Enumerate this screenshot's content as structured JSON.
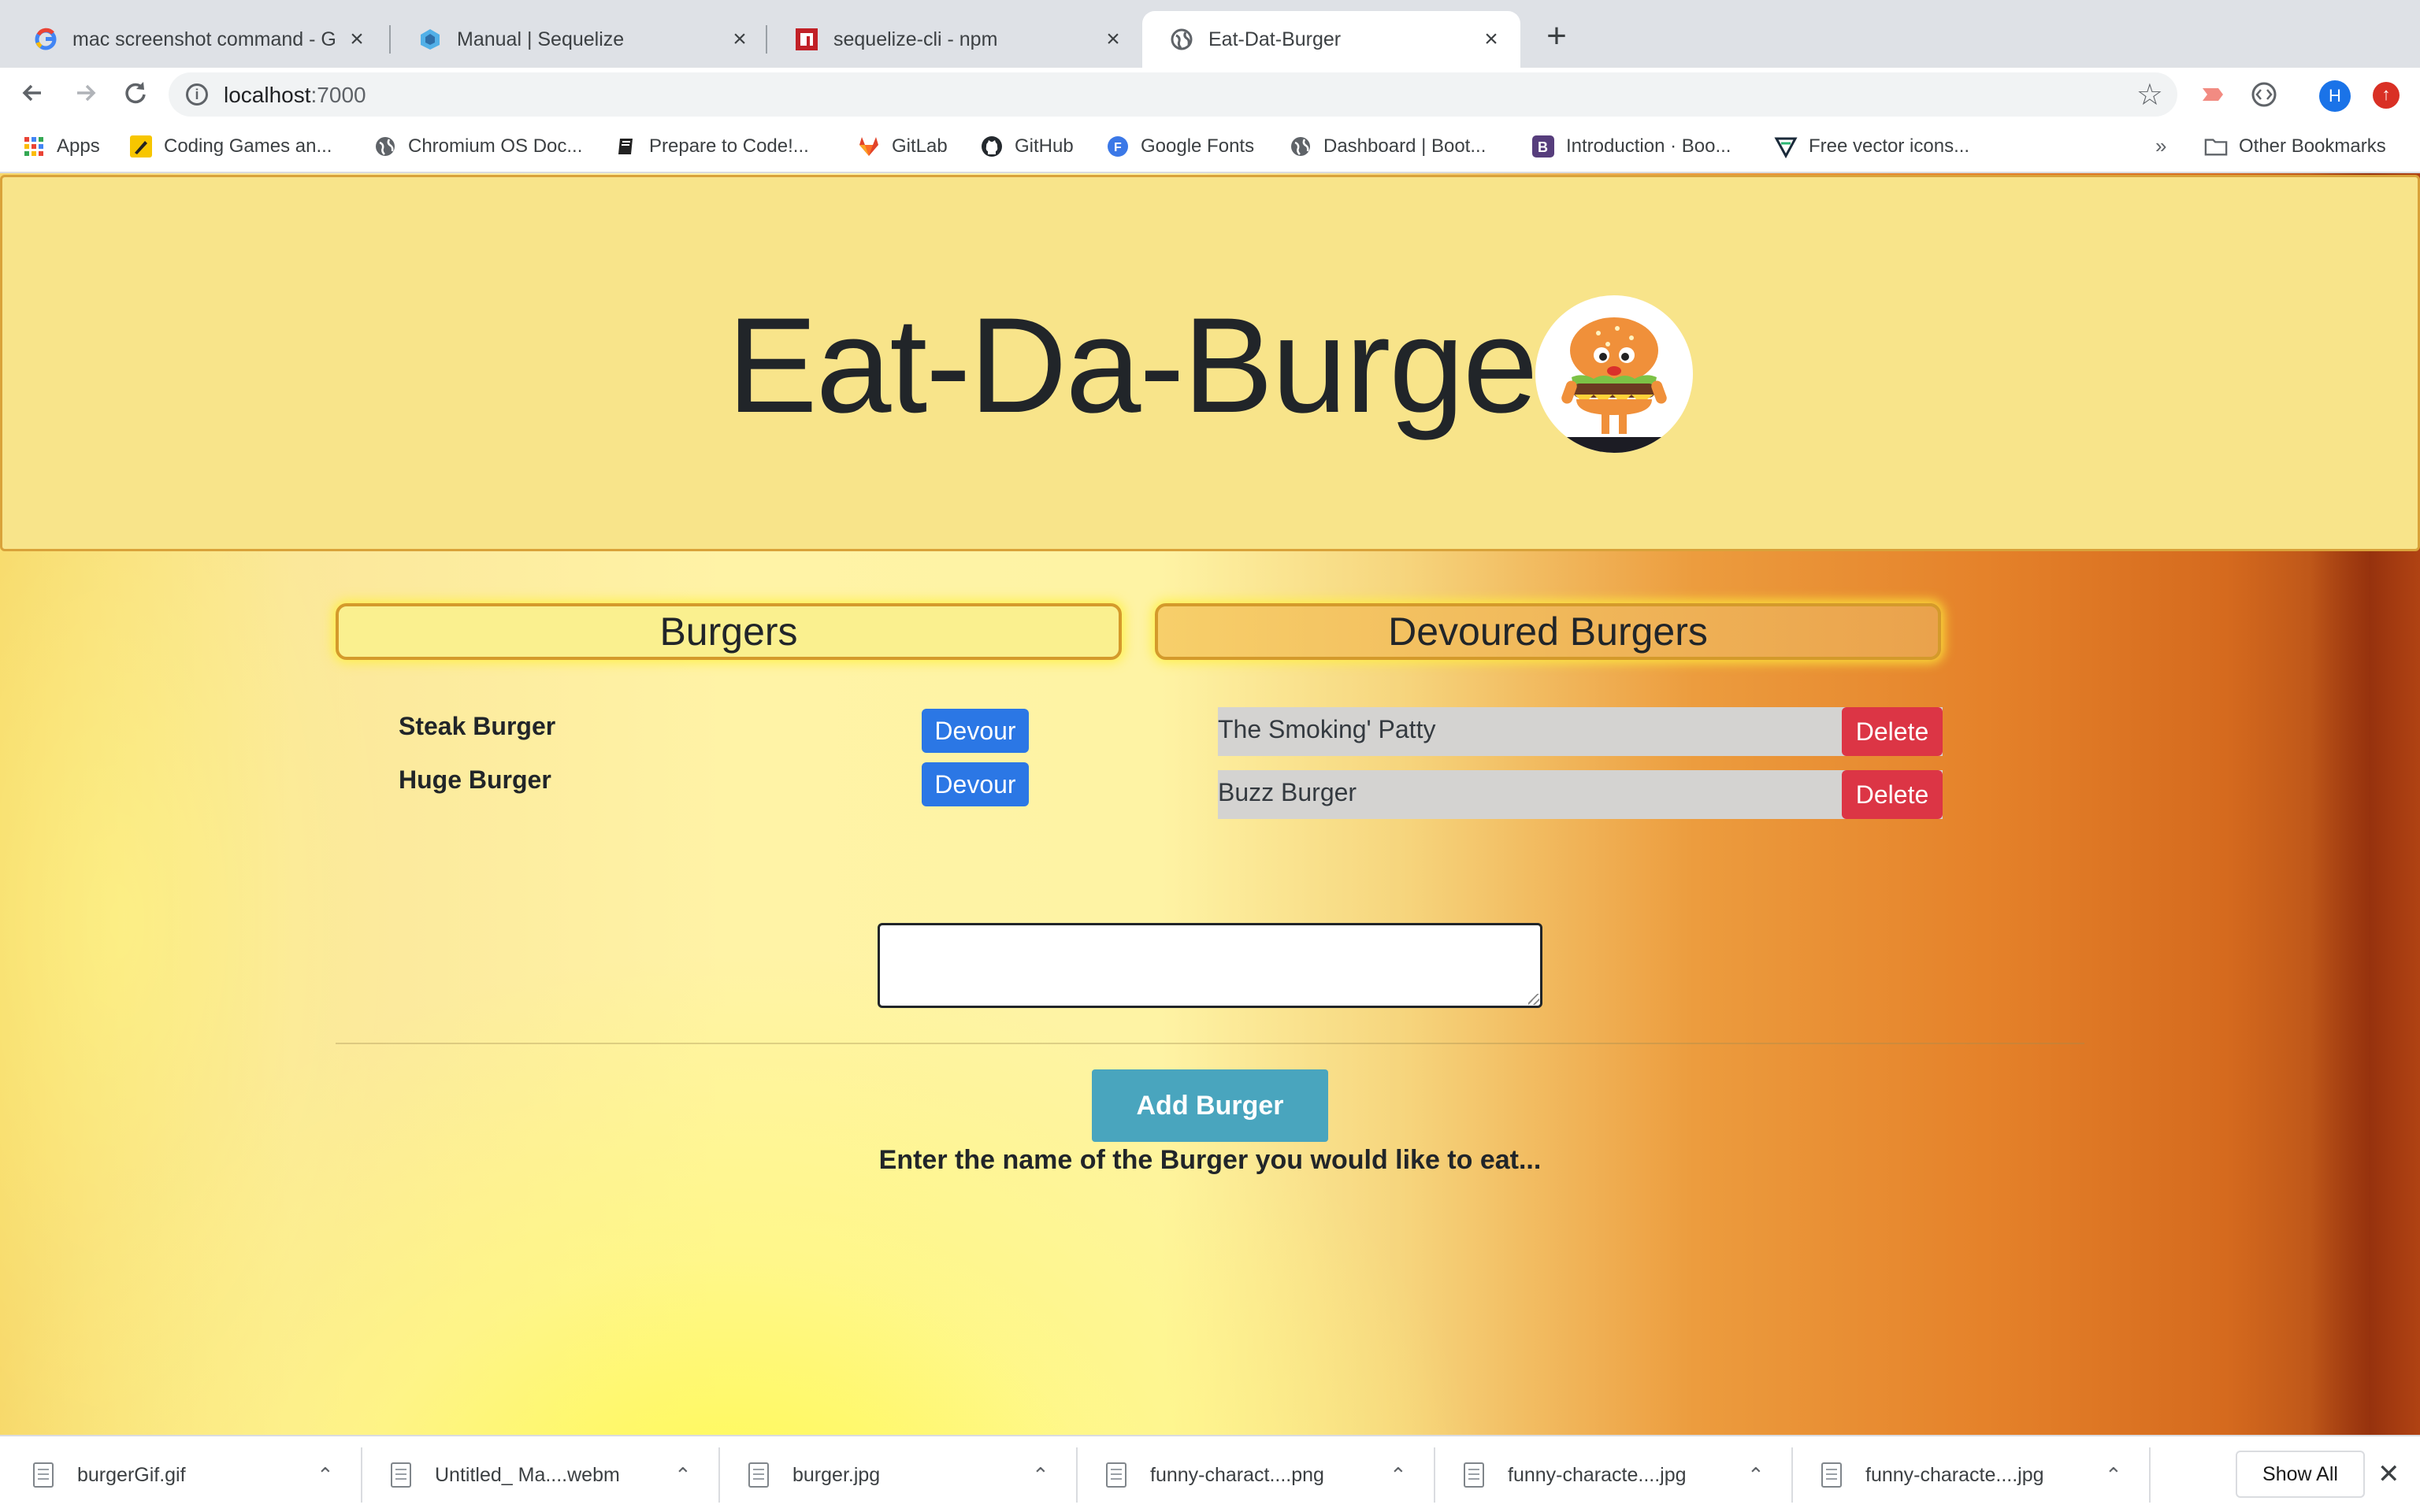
{
  "tabs": [
    {
      "title": "mac screenshot command - Go",
      "icon": "google-icon"
    },
    {
      "title": "Manual | Sequelize",
      "icon": "sequelize-icon"
    },
    {
      "title": "sequelize-cli - npm",
      "icon": "npm-icon"
    },
    {
      "title": "Eat-Dat-Burger",
      "icon": "globe-icon",
      "active": true
    }
  ],
  "toolbar": {
    "url_host": "localhost",
    "url_port": ":7000",
    "profile_initial": "H",
    "update_glyph": "↑"
  },
  "bookmarks": {
    "items": [
      {
        "label": "Apps",
        "icon": "apps-grid-icon"
      },
      {
        "label": "Coding Games an...",
        "icon": "coding-games-icon"
      },
      {
        "label": "Chromium OS Doc...",
        "icon": "globe-icon"
      },
      {
        "label": "Prepare to Code!...",
        "icon": "book-icon"
      },
      {
        "label": "GitLab",
        "icon": "gitlab-icon"
      },
      {
        "label": "GitHub",
        "icon": "github-icon"
      },
      {
        "label": "Google Fonts",
        "icon": "google-fonts-icon"
      },
      {
        "label": "Dashboard | Boot...",
        "icon": "globe-icon"
      },
      {
        "label": "Introduction · Boo...",
        "icon": "bootstrap-icon"
      },
      {
        "label": "Free vector icons...",
        "icon": "vector-icon"
      }
    ],
    "more": "»",
    "other": "Other Bookmarks"
  },
  "page": {
    "title": "Eat-Da-Burger",
    "burgers_heading": "Burgers",
    "devoured_heading": "Devoured Burgers",
    "burgers": [
      {
        "name": "Steak Burger",
        "action": "Devour"
      },
      {
        "name": "Huge Burger",
        "action": "Devour"
      }
    ],
    "devoured": [
      {
        "name": "The Smoking' Patty",
        "action": "Delete"
      },
      {
        "name": "Buzz Burger",
        "action": "Delete"
      }
    ],
    "input_value": "",
    "add_button": "Add Burger",
    "hint": "Enter the name of the Burger you would like to eat..."
  },
  "downloads": {
    "items": [
      {
        "name": "burgerGif.gif"
      },
      {
        "name": "Untitled_ Ma....webm"
      },
      {
        "name": "burger.jpg"
      },
      {
        "name": "funny-charact....png"
      },
      {
        "name": "funny-characte....jpg"
      },
      {
        "name": "funny-characte....jpg"
      }
    ],
    "show_all": "Show All"
  },
  "colors": {
    "jumbotron_bg": "#f8e48a",
    "devour_button": "#2b77e5",
    "delete_button": "#dc3545",
    "add_button": "#49a5be"
  }
}
